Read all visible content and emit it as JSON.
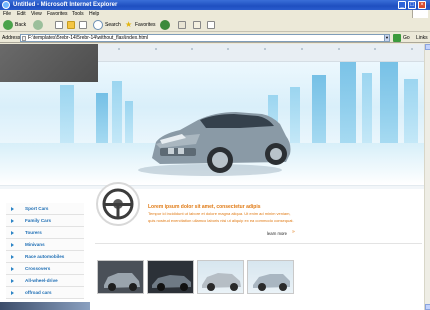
{
  "window": {
    "title": "Untitled - Microsoft Internet Explorer",
    "controls": [
      "_",
      "□",
      "×"
    ]
  },
  "menu": [
    "File",
    "Edit",
    "View",
    "Favorites",
    "Tools",
    "Help"
  ],
  "toolbar": {
    "back_label": "Back",
    "search_label": "Search",
    "favorites_label": "Favorites"
  },
  "address": {
    "label": "Address",
    "value": "F:\\templates\\5rebr-14\\5rebr-14\\without_flas\\index.html",
    "go_label": "Go",
    "links_label": "Links"
  },
  "sidebar": {
    "items": [
      {
        "label": "Sport Cars"
      },
      {
        "label": "Family Cars"
      },
      {
        "label": "Tourers"
      },
      {
        "label": "Minivans"
      },
      {
        "label": "Race automobiles"
      },
      {
        "label": "Crossovers"
      },
      {
        "label": "All-wheel-drive"
      },
      {
        "label": "offroad cars"
      }
    ]
  },
  "feature": {
    "title": "Lorem ipsum dolor sit amet, consectetur adipis",
    "body": "Tempor id incididunt ut labore et dolore magna aliqua. Ut enim ad minim veniam, quis nostrud exercitation ullamco laboris nisi ut aliquip ex ea commodo consequat.",
    "read_more": "learn more"
  },
  "colors": {
    "titlebar": "#2a5ccd",
    "accent_orange": "#e07a14",
    "link_blue": "#1f6fb5"
  }
}
